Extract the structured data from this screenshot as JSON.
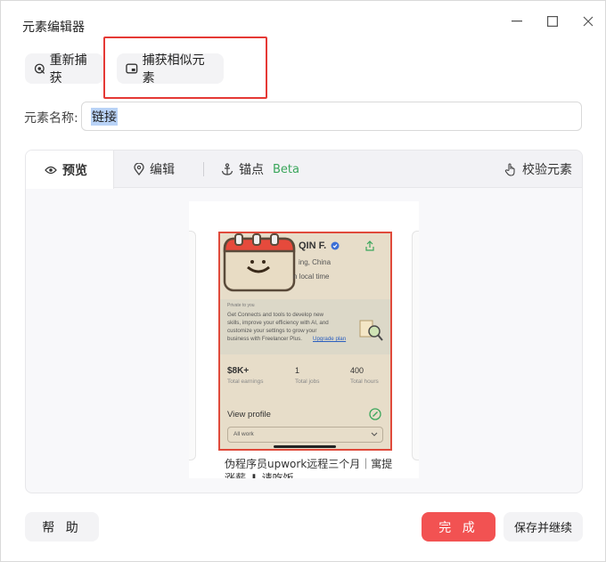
{
  "window": {
    "title": "元素编辑器"
  },
  "toolbar": {
    "recapture_label": "重新捕获",
    "capture_similar_label": "捕获相似元素"
  },
  "element_name": {
    "label": "元素名称:",
    "value": "链接"
  },
  "tabs": [
    {
      "label": "预览",
      "icon": "eye-icon"
    },
    {
      "label": "编辑",
      "icon": "map-pin-icon"
    },
    {
      "label": "锚点",
      "icon": "anchor-icon",
      "badge": "Beta"
    }
  ],
  "validate": {
    "label": "校验元素",
    "icon": "hand-pointer-icon"
  },
  "preview": {
    "profile_name": "QIN F.",
    "location": "ing, China",
    "local_time": "n local time",
    "promo_small": "Private to you",
    "promo_lines": [
      "Get Connects and tools to develop new",
      "skills, improve your efficiency with AI, and",
      "customize your settings to grow your",
      "business with Freelancer Plus."
    ],
    "promo_link": "Upgrade plan",
    "stats": [
      {
        "value": "$8K+",
        "label": "Total earnings"
      },
      {
        "value": "1",
        "label": "Total jobs"
      },
      {
        "value": "400",
        "label": "Total hours"
      }
    ],
    "view_profile": "View profile",
    "dropdown": "All work",
    "caption_line1": "伪程序员upwork远程三个月｜寓提",
    "caption_line2": "涨薪 ⬇ 请吃饭"
  },
  "footer": {
    "help_label": "帮 助",
    "done_label": "完 成",
    "save_continue_label": "保存并继续"
  },
  "colors": {
    "accent_red": "#f25252",
    "highlight_border": "#e53935",
    "beta_green": "#3aa65b",
    "selection_fill": "#e7ddc9"
  }
}
